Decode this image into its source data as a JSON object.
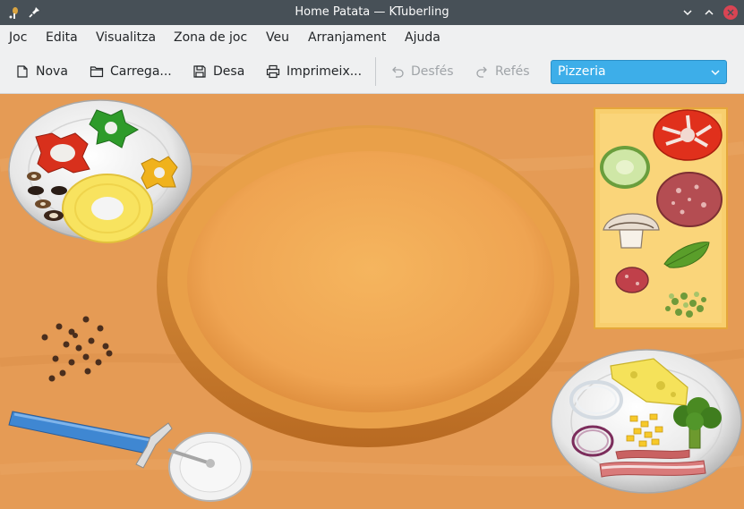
{
  "window": {
    "title": "Home Patata — KTuberling",
    "app_icon": "ktuberling-icon",
    "pin_icon": "pin-icon",
    "controls": [
      "chevron-down-icon",
      "chevron-up-icon",
      "close-icon"
    ]
  },
  "menubar": {
    "items": [
      "Joc",
      "Edita",
      "Visualitza",
      "Zona de joc",
      "Veu",
      "Arranjament",
      "Ajuda"
    ]
  },
  "toolbar": {
    "new_label": "Nova",
    "load_label": "Carrega...",
    "save_label": "Desa",
    "print_label": "Imprimeix...",
    "undo_label": "Desfés",
    "redo_label": "Refés",
    "playground_selected": "Pizzeria"
  },
  "colors": {
    "titlebar": "#475057",
    "accent": "#3daee9",
    "background": "#e59b55",
    "dough": "#f0a85a"
  }
}
